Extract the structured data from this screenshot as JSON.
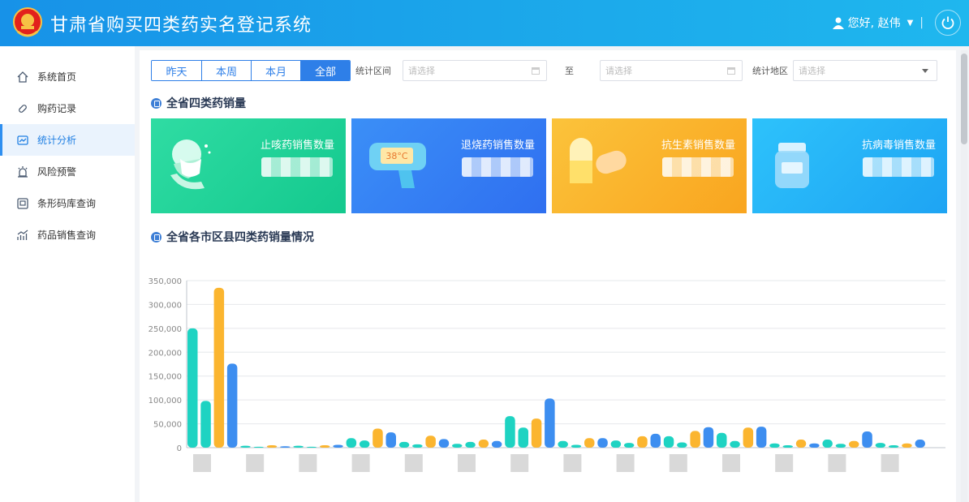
{
  "header": {
    "title": "甘肃省购买四类药实名登记系统",
    "greeting": "您好, 赵伟",
    "separator": "|"
  },
  "sidebar": {
    "items": [
      {
        "label": "系统首页",
        "icon": "home-icon"
      },
      {
        "label": "购药记录",
        "icon": "pill-icon"
      },
      {
        "label": "统计分析",
        "icon": "chart-icon",
        "active": true
      },
      {
        "label": "风险预警",
        "icon": "alarm-icon"
      },
      {
        "label": "条形码库查询",
        "icon": "barcode-icon"
      },
      {
        "label": "药品销售查询",
        "icon": "trend-icon"
      }
    ]
  },
  "filters": {
    "periods": [
      "昨天",
      "本周",
      "本月",
      "全部"
    ],
    "active_period": "全部",
    "range_label": "统计区间",
    "range_start_placeholder": "请选择",
    "range_to": "至",
    "range_end_placeholder": "请选择",
    "region_label": "统计地区",
    "region_placeholder": "请选择"
  },
  "summary": {
    "title": "全省四类药销量",
    "cards": [
      {
        "label": "止咳药销售数量",
        "icon": "cough-icon",
        "color": "#1fd29a"
      },
      {
        "label": "退烧药销售数量",
        "icon": "thermometer-icon",
        "thermo_text": "38°C",
        "color": "#3a86f5"
      },
      {
        "label": "抗生素销售数量",
        "icon": "capsule-icon",
        "color": "#fab42c"
      },
      {
        "label": "抗病毒销售数量",
        "icon": "medicine-jar-icon",
        "color": "#27b5f8"
      }
    ]
  },
  "regional": {
    "title": "全省各市区县四类药销量情况"
  },
  "chart_data": {
    "type": "bar",
    "ylim": [
      0,
      350000
    ],
    "yticks": [
      "0",
      "50,000",
      "100,000",
      "150,000",
      "200,000",
      "250,000",
      "300,000",
      "350,000"
    ],
    "colors": [
      "#1ed3c2",
      "#1ed3c2",
      "#fbb52f",
      "#3d8ef0"
    ],
    "groups": [
      [
        250000,
        98000,
        335000,
        176000
      ],
      [
        4000,
        2000,
        5000,
        3000
      ],
      [
        4000,
        2000,
        5000,
        6000
      ],
      [
        20000,
        15000,
        40000,
        32000
      ],
      [
        12000,
        7000,
        25000,
        18000
      ],
      [
        8000,
        12000,
        17000,
        14000
      ],
      [
        66000,
        42000,
        61000,
        103000
      ],
      [
        14000,
        6000,
        20000,
        20000
      ],
      [
        15000,
        10000,
        24000,
        29000
      ],
      [
        24000,
        11000,
        35000,
        43000
      ],
      [
        31000,
        14000,
        42000,
        44000
      ],
      [
        9000,
        5000,
        17000,
        9000
      ],
      [
        17000,
        8000,
        14000,
        34000
      ],
      [
        10000,
        5000,
        9000,
        17000
      ]
    ],
    "grid": true
  }
}
